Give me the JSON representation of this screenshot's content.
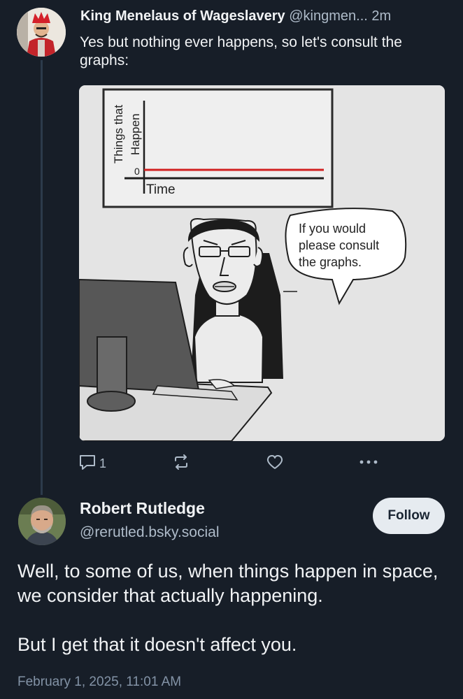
{
  "colors": {
    "background": "#171e28",
    "primary_text": "#f1f3f5",
    "secondary_text": "#aebbc9",
    "thread_line": "#2c3a4b",
    "graph_line": "#d12020"
  },
  "post1": {
    "author_name": "King Menelaus of Wageslavery",
    "handle": "@kingmen...",
    "time": "2m",
    "text": "Yes but nothing ever happens, so let's consult the graphs:",
    "image": {
      "graph_y_label_1": "Things that",
      "graph_y_label_2": "Happen",
      "graph_zero_tick": "0",
      "graph_x_label": "Time",
      "speech_line_1": "If you would",
      "speech_line_2": "please consult",
      "speech_line_3": "the graphs."
    },
    "actions": {
      "reply_count": "1",
      "reply_icon": "reply-icon",
      "repost_icon": "repost-icon",
      "like_icon": "heart-icon",
      "more_icon": "more-icon"
    }
  },
  "post2": {
    "author_name": "Robert Rutledge",
    "handle": "@rerutled.bsky.social",
    "follow_label": "Follow",
    "paragraphs": [
      "Well, to some of us, when things happen in space, we consider that actually happening.",
      "But I get that it doesn't affect you."
    ],
    "timestamp": "February 1, 2025, 11:01 AM"
  }
}
